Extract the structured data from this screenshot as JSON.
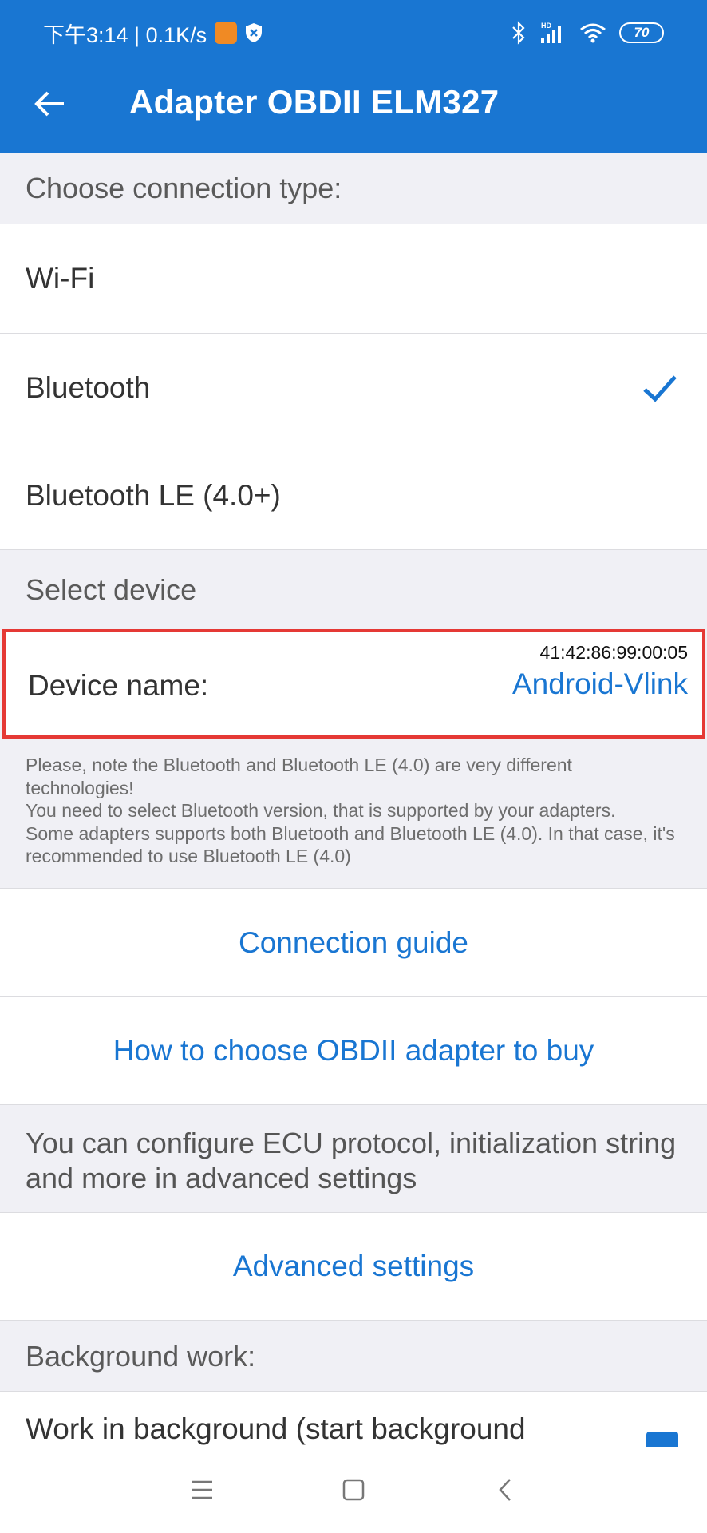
{
  "status_bar": {
    "time_speed": "下午3:14 | 0.1K/s",
    "battery": "70",
    "icons": [
      "app-badge-icon",
      "shield-icon",
      "bluetooth-icon",
      "hd-signal-icon",
      "wifi-icon",
      "battery-icon"
    ]
  },
  "toolbar": {
    "title": "Adapter OBDII ELM327",
    "back_icon": "arrow-left-icon"
  },
  "connection": {
    "header": "Choose connection type:",
    "options": [
      {
        "label": "Wi-Fi",
        "selected": false
      },
      {
        "label": "Bluetooth",
        "selected": true
      },
      {
        "label": "Bluetooth LE (4.0+)",
        "selected": false
      }
    ]
  },
  "device": {
    "header": "Select device",
    "label": "Device name:",
    "mac": "41:42:86:99:00:05",
    "name": "Android-Vlink"
  },
  "note": {
    "line1": "Please, note the Bluetooth and Bluetooth LE (4.0) are very different technologies!",
    "line2": "You need to select Bluetooth version, that is supported by your adapters.",
    "line3": "Some adapters supports both Bluetooth and Bluetooth LE (4.0). In that case, it's recommended to use Bluetooth LE (4.0)"
  },
  "links": {
    "connection_guide": "Connection guide",
    "how_to_choose": "How to choose OBDII adapter to buy",
    "advanced_settings": "Advanced settings"
  },
  "advanced_info": "You can configure ECU protocol, initialization string and more in advanced settings",
  "background": {
    "header": "Background work:",
    "option_label": "Work in background (start background",
    "checked": true
  },
  "nav_bar": {
    "icons": [
      "menu-icon",
      "home-icon",
      "back-icon"
    ]
  },
  "colors": {
    "primary": "#1976d2",
    "highlight_border": "#e53935",
    "section_bg": "#f0f0f5"
  }
}
